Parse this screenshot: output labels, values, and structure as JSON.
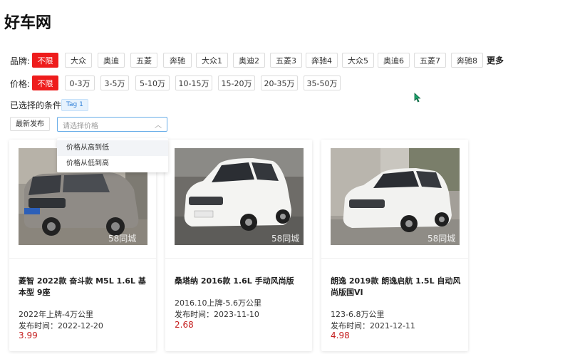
{
  "page": {
    "title": "好车网"
  },
  "brand_filter": {
    "label": "品牌:",
    "options": [
      "不限",
      "大众",
      "奥迪",
      "五菱",
      "奔驰",
      "大众1",
      "奥迪2",
      "五菱3",
      "奔驰4",
      "大众5",
      "奥迪6",
      "五菱7",
      "奔驰8"
    ],
    "selected": "不限",
    "more": "更多"
  },
  "price_filter": {
    "label": "价格:",
    "options": [
      "不限",
      "0-3万",
      "3-5万",
      "5-10万",
      "10-15万",
      "15-20万",
      "20-35万",
      "35-50万"
    ],
    "selected": "不限"
  },
  "selected_conditions": {
    "label": "已选择的条件:",
    "tag": "Tag 1"
  },
  "sort": {
    "latest_label": "最新发布",
    "price_placeholder": "请选择价格",
    "options": [
      "价格从高到低",
      "价格从低到高"
    ]
  },
  "cars": [
    {
      "title": "菱智 2022款 奋斗款 M5L 1.6L 基本型 9座",
      "plate_mileage": "2022年上牌-4万公里",
      "published": "发布时间：2022-12-20",
      "price": "3.99",
      "watermark": "58同城"
    },
    {
      "title": "桑塔纳 2016款 1.6L 手动风尚版",
      "plate_mileage": "2016.10上牌-5.6万公里",
      "published": "发布时间：2023-11-10",
      "price": "2.68",
      "watermark": "58同城"
    },
    {
      "title": "朗逸 2019款 朗逸启航 1.5L 自动风尚版国VI",
      "plate_mileage": "123-6.8万公里",
      "published": "发布时间：2021-12-11",
      "price": "4.98",
      "watermark": "58同城"
    }
  ],
  "colors": {
    "accent": "#ee1c1c",
    "price": "#c41d1d",
    "tag_text": "#2f7fd8",
    "select_border": "#6aaee8"
  }
}
